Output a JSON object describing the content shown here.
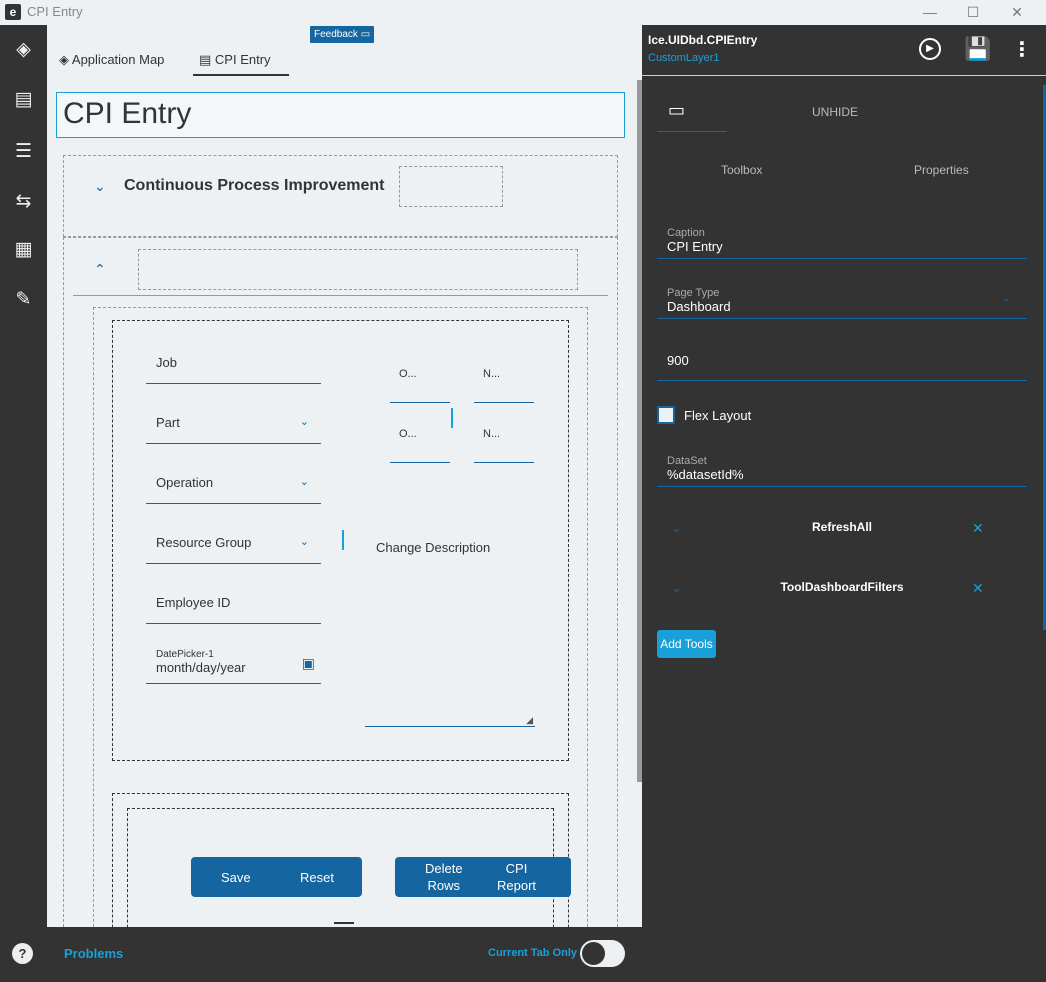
{
  "window": {
    "title": "CPI Entry",
    "minimize": "—",
    "maximize": "☐",
    "close": "✕"
  },
  "sidebar": {
    "icons": [
      "layers-icon",
      "layout-icon",
      "checklist-icon",
      "flow-icon",
      "grid-icon",
      "edit-document-icon"
    ],
    "help": "?"
  },
  "canvas": {
    "feedback": "Feedback",
    "tabs": [
      {
        "label": "Application Map",
        "icon": "layers-icon"
      },
      {
        "label": "CPI Entry",
        "icon": "layout-icon",
        "active": true
      }
    ],
    "page_title": "CPI Entry",
    "section_title": "Continuous Process Improvement",
    "fields": {
      "job": "Job",
      "part": "Part",
      "operation": "Operation",
      "resource_group": "Resource Group",
      "employee_id": "Employee ID",
      "date_label": "DatePicker-1",
      "date_placeholder": "month/day/year",
      "change_description": "Change Description",
      "small": [
        "O...",
        "N...",
        "O...",
        "N..."
      ]
    },
    "buttons": {
      "save": "Save",
      "reset": "Reset",
      "delete_rows_1": "Delete",
      "delete_rows_2": "Rows",
      "cpi_report_1": "CPI",
      "cpi_report_2": "Report"
    }
  },
  "bottombar": {
    "problems": "Problems",
    "current_tab_only": "Current Tab Only",
    "toggle_on": false
  },
  "right": {
    "path": "Ice.UIDbd.CPIEntry",
    "layer": "CustomLayer1",
    "unhide": "UNHIDE",
    "toolbox": "Toolbox",
    "properties": "Properties",
    "caption_label": "Caption",
    "caption_value": "CPI Entry",
    "page_type_label": "Page Type",
    "page_type_value": "Dashboard",
    "width_value": "900",
    "flex_layout": "Flex Layout",
    "flex_checked": false,
    "dataset_label": "DataSet",
    "dataset_value": "%datasetId%",
    "tools": [
      "RefreshAll",
      "ToolDashboardFilters"
    ],
    "add_tools": "Add Tools"
  },
  "colors": {
    "accent": "#1565a0",
    "highlight": "#1aa0d8",
    "dark": "#333333"
  }
}
